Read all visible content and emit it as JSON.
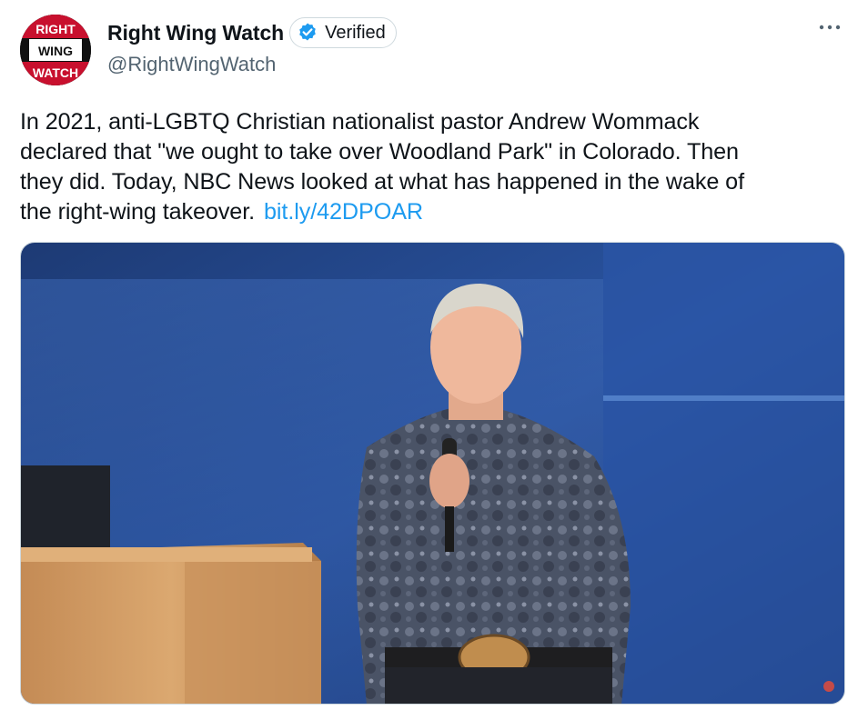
{
  "author": {
    "display_name": "Right Wing Watch",
    "handle": "@RightWingWatch",
    "verified_label": "Verified",
    "avatar_lines": [
      "RIGHT",
      "WING",
      "WATCH"
    ],
    "verified_color": "#1d9bf0"
  },
  "more_icon": "more-horizontal-icon",
  "tweet": {
    "lines": [
      "In 2021, anti-LGBTQ Christian nationalist pastor Andrew Wommack",
      "declared that \"we ought to take over Woodland Park\" in Colorado. Then",
      "they did. Today, NBC News looked at what has happened in the wake of"
    ],
    "last_line": "the right-wing takeover.",
    "link_text": "bit.ly/42DPOAR",
    "link_color": "#1d9bf0"
  },
  "media": {
    "type": "video-frame",
    "description_icon": "video-thumbnail"
  }
}
